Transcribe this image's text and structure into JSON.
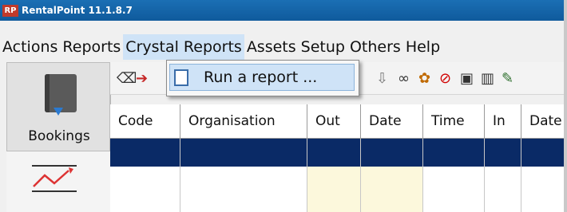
{
  "window": {
    "logo_text": "RP",
    "title": "RentalPoint 11.1.8.7"
  },
  "menu": {
    "items": [
      {
        "label": "Actions",
        "active": false
      },
      {
        "label": "Reports",
        "active": false
      },
      {
        "label": "Crystal Reports",
        "active": true
      },
      {
        "label": "Assets",
        "active": false
      },
      {
        "label": "Setup",
        "active": false
      },
      {
        "label": "Others",
        "active": false
      },
      {
        "label": "Help",
        "active": false
      }
    ]
  },
  "dropdown": {
    "items": [
      {
        "label": "Run a report ...",
        "icon": "report-icon",
        "highlighted": true
      }
    ]
  },
  "sidebar": {
    "bookings_label": "Bookings",
    "bookings_icon": "book-icon",
    "chart_icon": "chart-trend-icon"
  },
  "toolbar": {
    "icons": [
      "eraser-icon",
      "arrow-add-icon",
      "arrow-down-icon",
      "binoculars-icon",
      "colors-icon",
      "cancel-icon",
      "copy-icon",
      "trash-icon",
      "edit-icon"
    ]
  },
  "grid": {
    "columns": [
      "Code",
      "Organisation",
      "Out",
      "Date",
      "Time",
      "In",
      "Date"
    ]
  },
  "colors": {
    "selected_row": "#0a2a66",
    "menu_highlight": "#cfe3f7",
    "date_cell_bg": "#fcf8dc"
  }
}
